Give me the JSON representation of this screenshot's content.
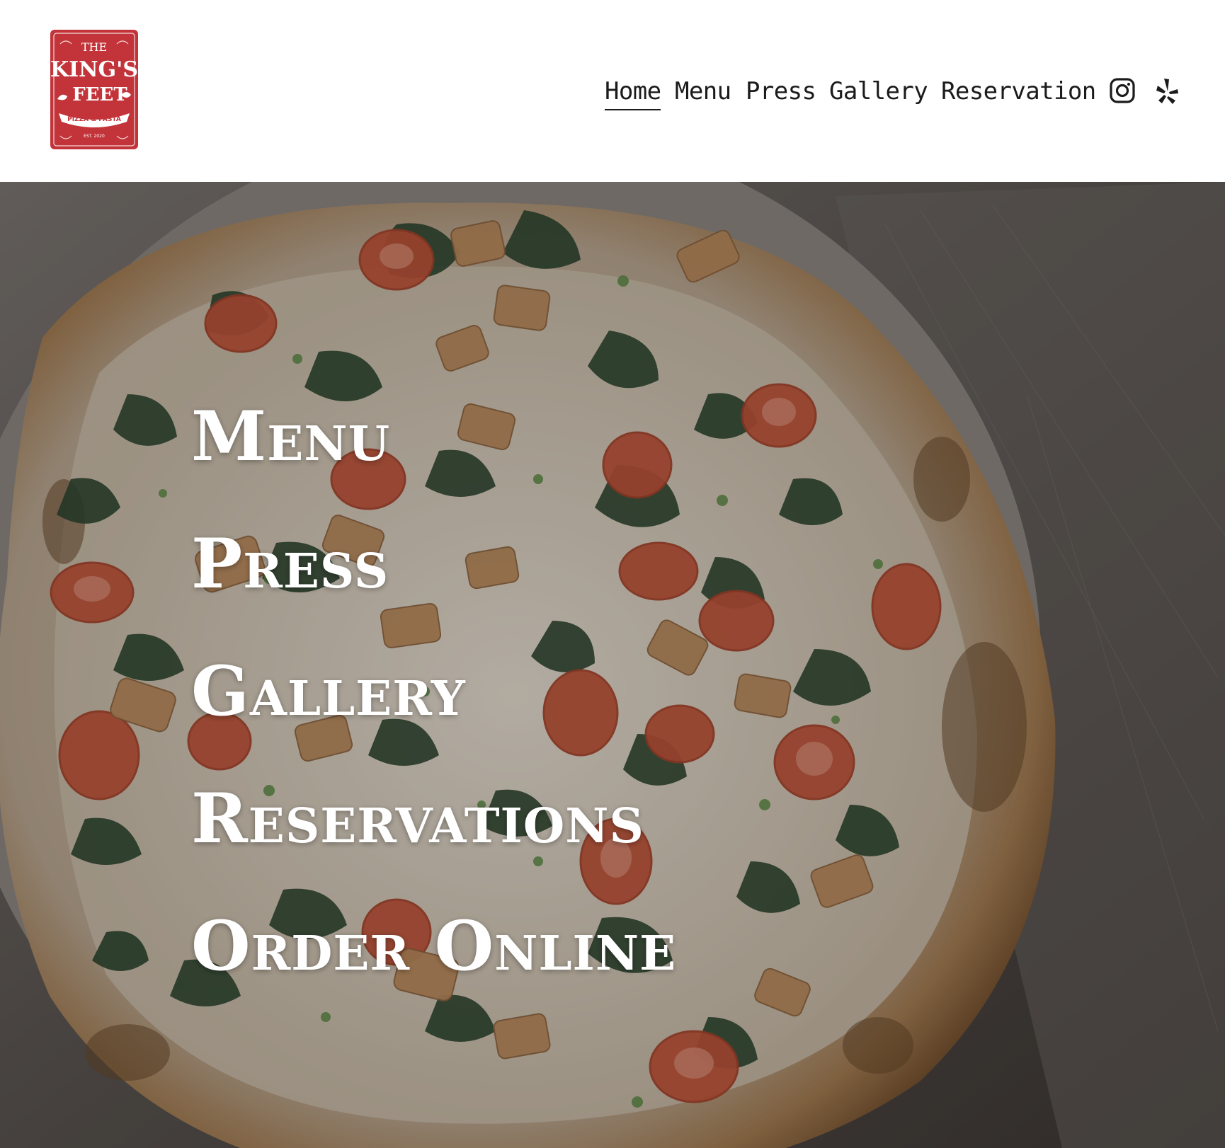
{
  "brand": {
    "logo_text_line1": "THE",
    "logo_text_line2": "KING'S",
    "logo_text_line3": "FEET",
    "logo_ribbon": "PIZZA & PASTA",
    "logo_est": "EST. 2020",
    "logo_color": "#c3343a"
  },
  "nav": {
    "items": [
      {
        "label": "Home",
        "active": true
      },
      {
        "label": "Menu"
      },
      {
        "label": "Press"
      },
      {
        "label": "Gallery"
      },
      {
        "label": "Reservation"
      }
    ],
    "social": [
      {
        "icon": "instagram-icon"
      },
      {
        "icon": "yelp-icon"
      }
    ]
  },
  "hero": {
    "links": [
      {
        "label": "Menu"
      },
      {
        "label": "Press"
      },
      {
        "label": "Gallery"
      },
      {
        "label": "Reservations"
      },
      {
        "label": "Order Online"
      }
    ]
  }
}
